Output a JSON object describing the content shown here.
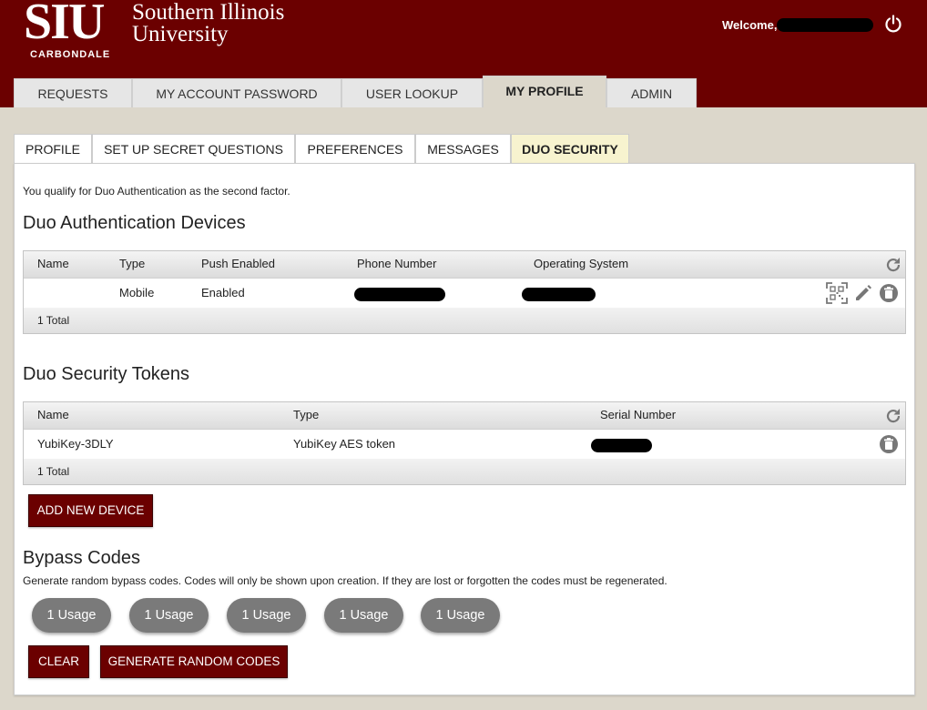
{
  "header": {
    "logo_abbr": "SIU",
    "logo_campus": "CARBONDALE",
    "logo_line1": "Southern Illinois",
    "logo_line2": "University",
    "welcome": "Welcome,",
    "power_icon": "power-icon"
  },
  "main_tabs": [
    {
      "label": "REQUESTS"
    },
    {
      "label": "MY ACCOUNT PASSWORD"
    },
    {
      "label": "USER LOOKUP"
    },
    {
      "label": "MY PROFILE"
    },
    {
      "label": "ADMIN"
    }
  ],
  "active_main_tab": "MY PROFILE",
  "sub_tabs": [
    {
      "label": "PROFILE"
    },
    {
      "label": "SET UP SECRET QUESTIONS"
    },
    {
      "label": "PREFERENCES"
    },
    {
      "label": "MESSAGES"
    },
    {
      "label": "DUO SECURITY"
    }
  ],
  "active_sub_tab": "DUO SECURITY",
  "intro": "You qualify for Duo Authentication as the second factor.",
  "devices": {
    "title": "Duo Authentication Devices",
    "columns": [
      "Name",
      "Type",
      "Push Enabled",
      "Phone Number",
      "Operating System"
    ],
    "rows": [
      {
        "name": "",
        "type": "Mobile",
        "push_enabled": "Enabled",
        "phone_number": "",
        "operating_system": ""
      }
    ],
    "footer": "1 Total"
  },
  "tokens": {
    "title": "Duo Security Tokens",
    "columns": [
      "Name",
      "Type",
      "Serial Number"
    ],
    "rows": [
      {
        "name": "YubiKey-3DLY",
        "type": "YubiKey AES token",
        "serial_number": ""
      }
    ],
    "footer": "1 Total"
  },
  "add_device_label": "ADD NEW DEVICE",
  "bypass": {
    "title": "Bypass Codes",
    "description": "Generate random bypass codes. Codes will only be shown upon creation. If they are lost or forgotten the codes must be regenerated.",
    "usages": [
      "1 Usage",
      "1 Usage",
      "1 Usage",
      "1 Usage",
      "1 Usage"
    ],
    "clear_label": "CLEAR",
    "generate_label": "GENERATE RANDOM CODES"
  },
  "colors": {
    "brand": "#6b0000",
    "active_subtab": "#f7f3cf",
    "pill": "#7a7a7a",
    "background": "#dcd7cb"
  }
}
